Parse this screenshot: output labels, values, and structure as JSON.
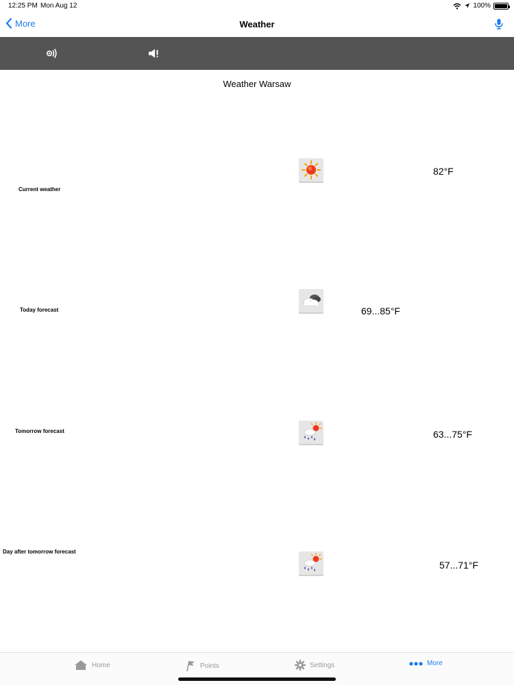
{
  "status_bar": {
    "time": "12:25 PM",
    "date": "Mon Aug 12",
    "battery": "100%"
  },
  "nav": {
    "back_label": "More",
    "title": "Weather"
  },
  "page": {
    "heading": "Weather Warsaw"
  },
  "rows": [
    {
      "label": "Current weather",
      "icon": "sun-icon",
      "temp": "82°F"
    },
    {
      "label": "Today forecast",
      "icon": "cloud-icon",
      "temp": "69...85°F"
    },
    {
      "label": "Tomorrow forecast",
      "icon": "rain-sun-icon",
      "temp": "63...75°F"
    },
    {
      "label": "Day after tomorrow forecast",
      "icon": "rain-sun-icon",
      "temp": "57...71°F"
    }
  ],
  "tabs": [
    {
      "label": "Home",
      "icon": "home-icon",
      "active": false
    },
    {
      "label": "Points",
      "icon": "flag-icon",
      "active": false
    },
    {
      "label": "Settings",
      "icon": "gear-icon",
      "active": false
    },
    {
      "label": "More",
      "icon": "more-dots-icon",
      "active": true
    }
  ],
  "colors": {
    "accent": "#1a7cf0",
    "toolbar": "#545454",
    "inactive": "#999999"
  }
}
